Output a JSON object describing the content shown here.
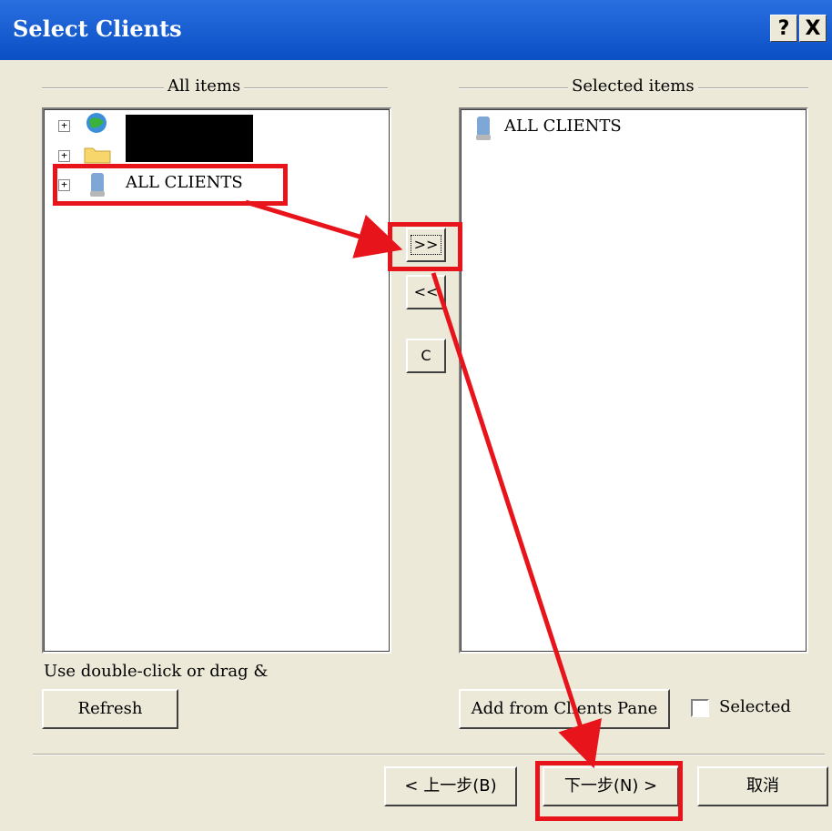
{
  "dialog": {
    "title": "Select Clients",
    "help_label": "?",
    "close_label": "X"
  },
  "left_panel": {
    "group_label": "All items",
    "tree": [
      {
        "label": "",
        "icon": "network-globe-icon",
        "expander": "+"
      },
      {
        "label": "",
        "icon": "folder-icon",
        "expander": "+"
      },
      {
        "label": "ALL CLIENTS",
        "icon": "client-computer-icon",
        "expander": "+"
      }
    ],
    "hint": "Use double-click or drag &",
    "refresh_button": "Refresh"
  },
  "transfer_buttons": {
    "add": ">>",
    "remove": "<<",
    "clear": "C"
  },
  "right_panel": {
    "group_label": "Selected items",
    "items": [
      {
        "label": "ALL CLIENTS",
        "icon": "client-computer-icon"
      }
    ],
    "add_from_pane_button": "Add from Clients Pane",
    "selected_checkbox_label": "Selected",
    "selected_checked": false
  },
  "footer": {
    "back_button": "< 上一步(B)",
    "next_button": "下一步(N) >",
    "cancel_button": "取消"
  },
  "annotation_color": "#e8141b"
}
